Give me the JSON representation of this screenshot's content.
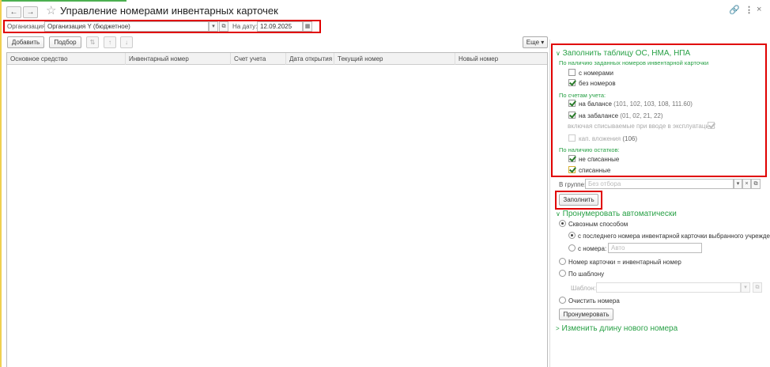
{
  "window": {
    "title": "Управление номерами инвентарных карточек"
  },
  "toolbar": {
    "org_label": "Организация:",
    "org_value": "Организация Y (бюджетное)",
    "date_label": "На дату:",
    "date_value": "12.09.2025",
    "add_label": "Добавить",
    "select_label": "Подбор",
    "more_label": "Еще"
  },
  "table": {
    "columns": [
      "Основное средство",
      "Инвентарный номер",
      "Счет учета",
      "Дата открытия",
      "Текущий номер",
      "Новый номер"
    ]
  },
  "fill_section": {
    "title": "Заполнить таблицу ОС, НМА, НПА",
    "group_inventory": "По наличию заданных номеров инвентарной карточки",
    "with_numbers": "с номерами",
    "with_numbers_checked": false,
    "without_numbers": "без номеров",
    "without_numbers_checked": true,
    "group_accounts": "По счетам учета:",
    "balance_label": "на балансе",
    "balance_accounts": "(101, 102, 103, 108, 111.60)",
    "balance_checked": true,
    "offbalance_label": "на забалансе",
    "offbalance_accounts": "(01, 02, 21, 22)",
    "offbalance_checked": true,
    "including_label": "включая списываемые при вводе в эксплуатацию:",
    "including_checked": true,
    "capital_label": "кап. вложения",
    "capital_accounts": "(106)",
    "capital_checked": false,
    "group_remains": "По наличию остатков:",
    "not_written_off": "не списанные",
    "not_written_off_checked": true,
    "written_off": "списанные",
    "written_off_checked": true,
    "in_group_label": "В группе:",
    "in_group_placeholder": "Без отбора",
    "fill_button": "Заполнить"
  },
  "numbering_section": {
    "title": "Пронумеровать автоматически",
    "through_label": "Сквозным способом",
    "from_last_label": "с последнего номера инвентарной карточки выбранного учреждения",
    "from_number_label": "с номера:",
    "from_number_placeholder": "Авто",
    "card_eq_inv_label": "Номер карточки = инвентарный номер",
    "by_template_label": "По шаблону",
    "template_label": "Шаблон:",
    "clear_label": "Очистить номера",
    "number_button": "Пронумеровать"
  },
  "change_length_section": {
    "title": "Изменить длину нового номера"
  }
}
